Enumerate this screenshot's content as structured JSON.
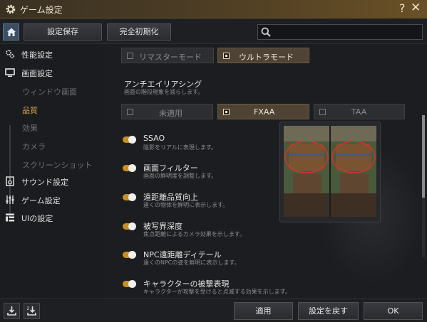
{
  "title": "ゲーム設定",
  "window_controls": {
    "help": "?",
    "close": "✕"
  },
  "toolbar": {
    "save_label": "設定保存",
    "reset_label": "完全初期化",
    "search_placeholder": ""
  },
  "sidebar": {
    "items": [
      {
        "label": "性能設定",
        "icon": "gears-icon"
      },
      {
        "label": "画面設定",
        "icon": "monitor-icon"
      },
      {
        "label": "ウィンドウ画面",
        "sub": true
      },
      {
        "label": "品質",
        "sub": true,
        "active": true
      },
      {
        "label": "効果",
        "sub": true
      },
      {
        "label": "カメラ",
        "sub": true
      },
      {
        "label": "スクリーンショット",
        "sub": true
      },
      {
        "label": "サウンド設定",
        "icon": "speaker-icon"
      },
      {
        "label": "ゲーム設定",
        "icon": "sliders-icon"
      },
      {
        "label": "UIの設定",
        "icon": "ui-layout-icon"
      }
    ]
  },
  "content": {
    "mode_options": [
      {
        "label": "リマスターモード",
        "selected": false
      },
      {
        "label": "ウルトラモード",
        "selected": true
      }
    ],
    "antialiasing": {
      "title": "アンチエイリアシング",
      "desc": "画面の階段現象を減らします。",
      "options": [
        {
          "label": "未適用",
          "selected": false
        },
        {
          "label": "FXAA",
          "selected": true
        },
        {
          "label": "TAA",
          "selected": false
        }
      ]
    },
    "settings": [
      {
        "title": "SSAO",
        "desc": "陰影をリアルに表現します。",
        "enabled": true
      },
      {
        "title": "画面フィルター",
        "desc": "画面の鮮明度を調整します。",
        "enabled": true
      },
      {
        "title": "遠距離品質向上",
        "desc": "遠くの物体を鮮明に表示します。",
        "enabled": true
      },
      {
        "title": "被写界深度",
        "desc": "焦点距離によるカメラ効果を示します。",
        "enabled": true
      },
      {
        "title": "NPC遠距離ディテール",
        "desc": "遠くのNPCの姿を鮮明に表示します。",
        "enabled": true
      },
      {
        "title": "キャラクターの被撃表現",
        "desc": "キャラクターが攻撃を受けると点滅する効果を示します。",
        "enabled": true
      }
    ]
  },
  "footer": {
    "apply_label": "適用",
    "revert_label": "設定を戻す",
    "ok_label": "OK"
  },
  "colors": {
    "accent": "#d8a64a",
    "toggle_on": "#c98f1f",
    "selected_option": "#4e4334"
  }
}
